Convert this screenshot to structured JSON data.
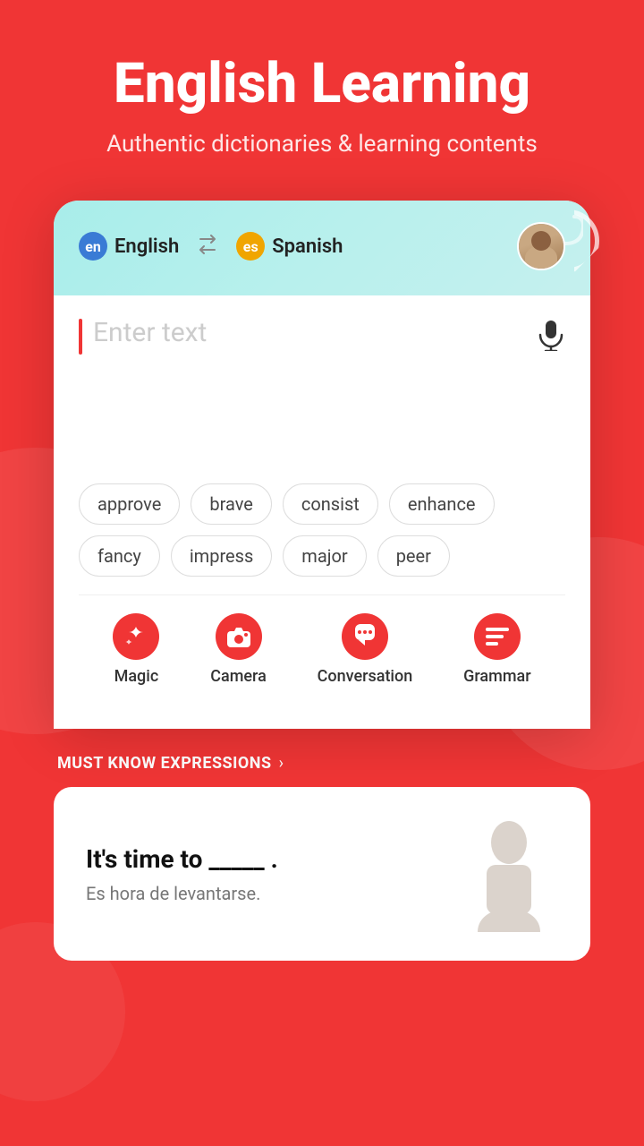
{
  "header": {
    "title": "English Learning",
    "subtitle": "Authentic dictionaries & learning contents"
  },
  "translator": {
    "source_lang": "English",
    "source_lang_code": "en",
    "target_lang": "Spanish",
    "target_lang_code": "es",
    "input_placeholder": "Enter text"
  },
  "suggestions": {
    "chips": [
      "approve",
      "brave",
      "consist",
      "enhance",
      "fancy",
      "impress",
      "major",
      "peer"
    ]
  },
  "nav_items": [
    {
      "id": "magic",
      "label": "Magic",
      "icon": "magic"
    },
    {
      "id": "camera",
      "label": "Camera",
      "icon": "camera"
    },
    {
      "id": "conversation",
      "label": "Conversation",
      "icon": "mic"
    },
    {
      "id": "grammar",
      "label": "Grammar",
      "icon": "grammar"
    }
  ],
  "expressions_section": {
    "title": "MUST KNOW EXPRESSIONS",
    "expression_main": "It's time to _____ .",
    "expression_translation": "Es hora de levantarse."
  },
  "colors": {
    "brand_red": "#f03535",
    "teal_gradient_start": "#a8edea",
    "teal_gradient_end": "#c5f0ee"
  }
}
